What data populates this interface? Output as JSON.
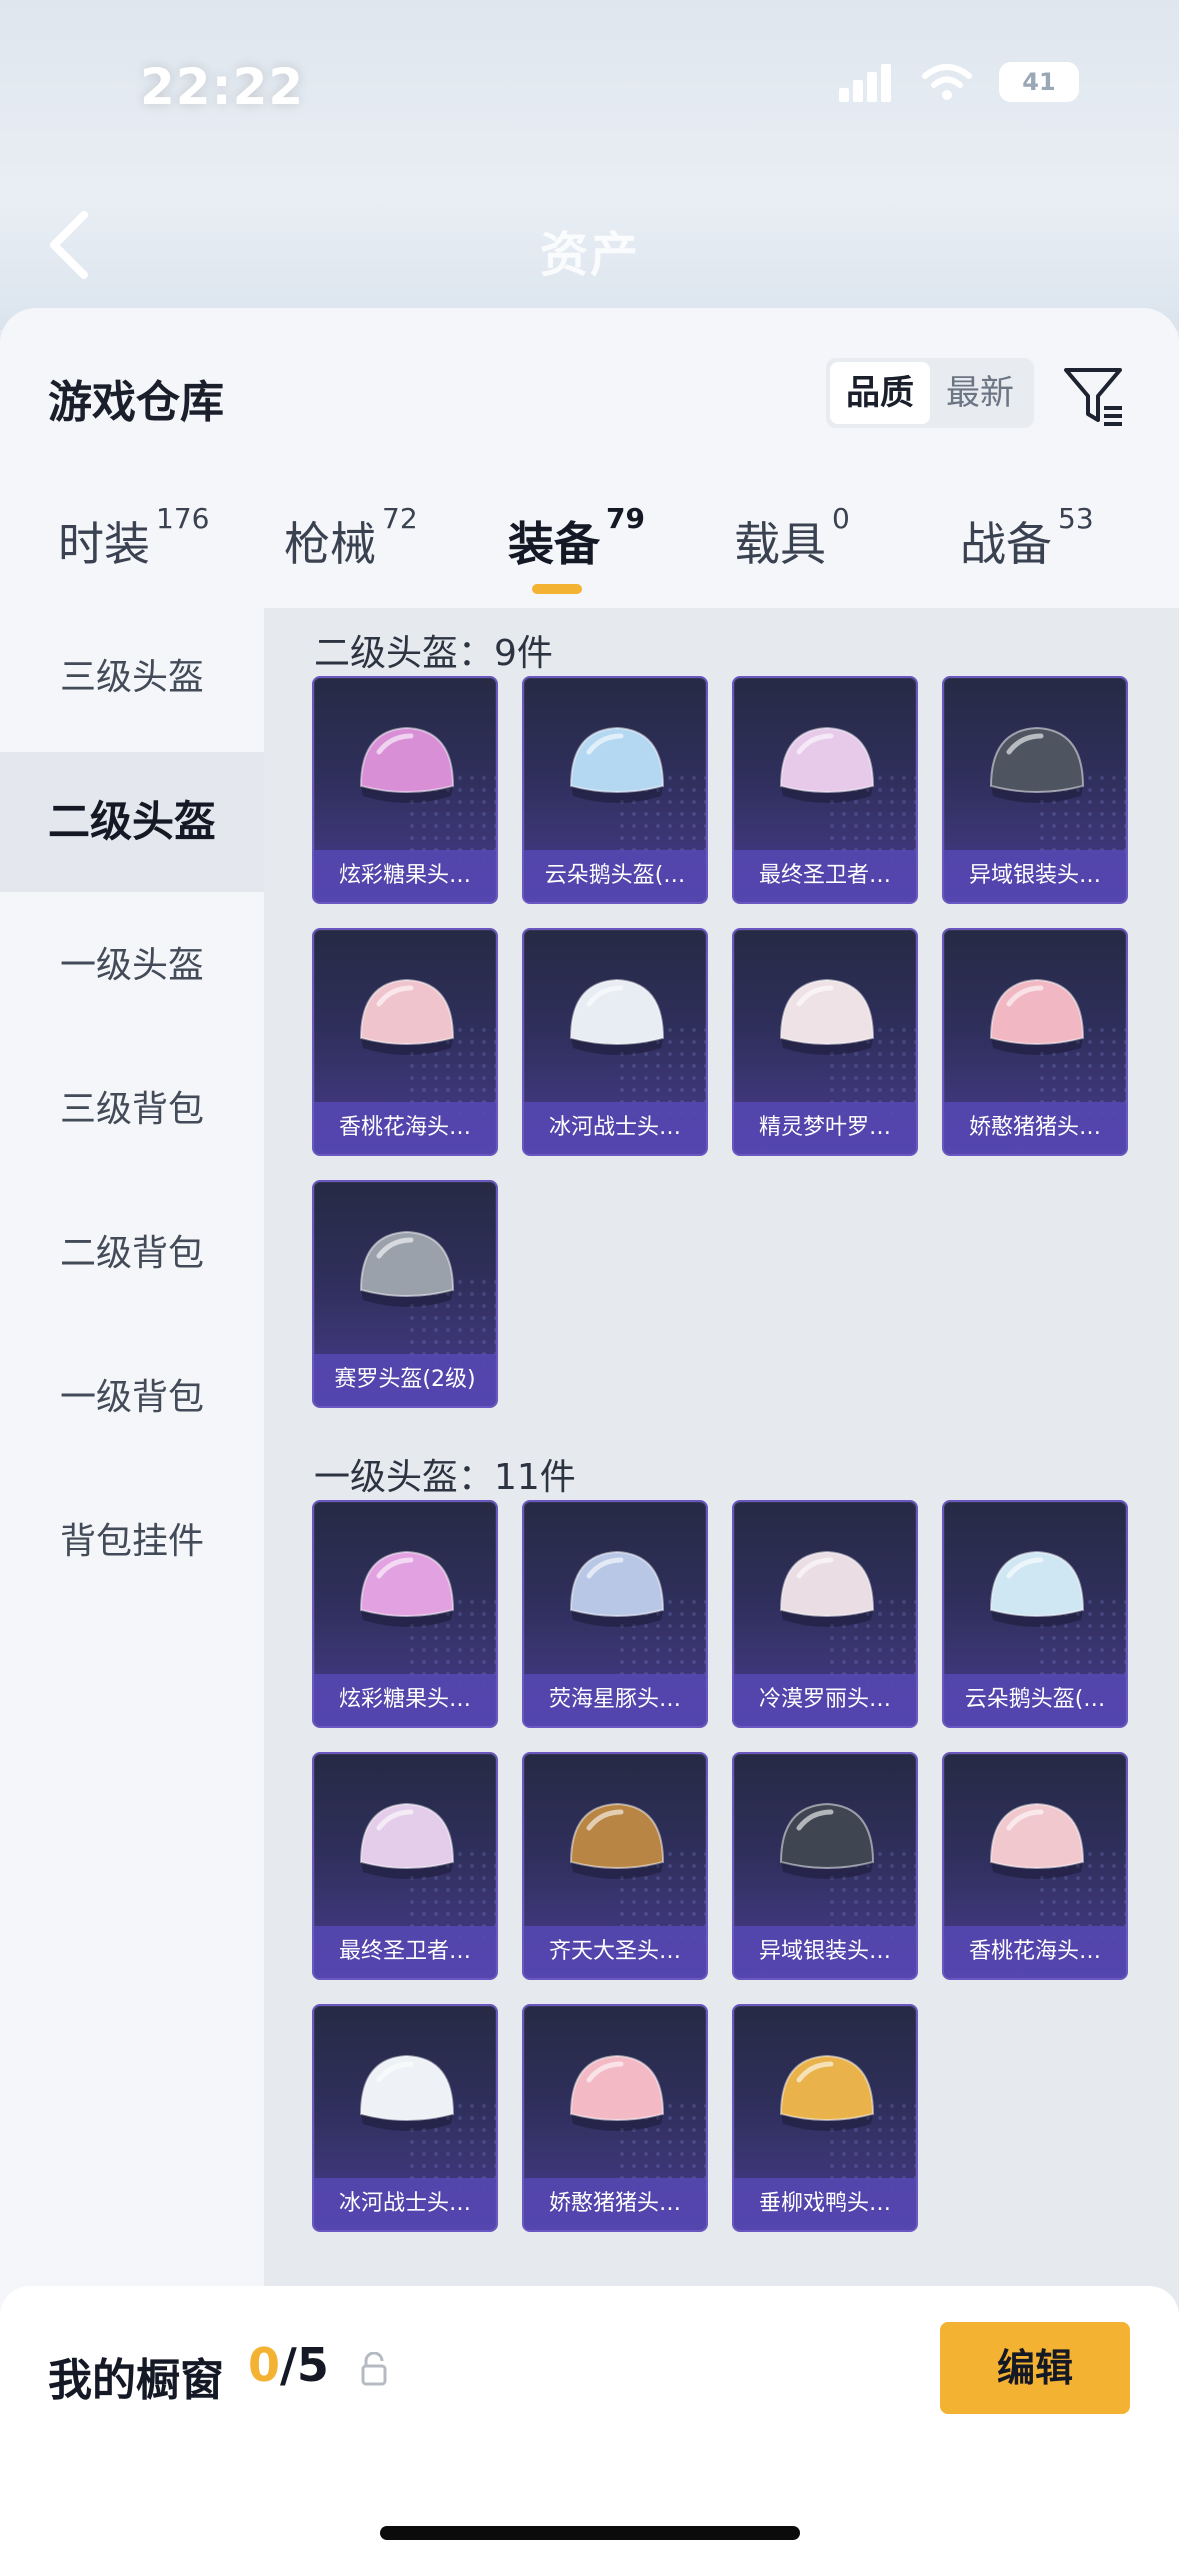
{
  "status_bar": {
    "time": "22:22",
    "battery": "41"
  },
  "top_nav": {
    "title": "资产"
  },
  "sheet": {
    "title": "游戏仓库",
    "sort": {
      "options": [
        "品质",
        "最新"
      ],
      "selected": "品质"
    }
  },
  "categories": [
    {
      "label": "时装",
      "count": "176"
    },
    {
      "label": "枪械",
      "count": "72"
    },
    {
      "label": "装备",
      "count": "79"
    },
    {
      "label": "载具",
      "count": "0"
    },
    {
      "label": "战备",
      "count": "53"
    }
  ],
  "active_category": "装备",
  "side_nav": {
    "items": [
      "三级头盔",
      "二级头盔",
      "一级头盔",
      "三级背包",
      "二级背包",
      "一级背包",
      "背包挂件"
    ],
    "active": "二级头盔"
  },
  "sections": [
    {
      "title": "二级头盔：9件",
      "items": [
        {
          "name": "炫彩糖果头…",
          "color": "#d88fd6"
        },
        {
          "name": "云朵鹅头盔(…",
          "color": "#b5d8f2"
        },
        {
          "name": "最终圣卫者…",
          "color": "#e7c9ea"
        },
        {
          "name": "异域银装头…",
          "color": "#4f5560"
        },
        {
          "name": "香桃花海头…",
          "color": "#f0c4cc"
        },
        {
          "name": "冰河战士头…",
          "color": "#e8ecf3"
        },
        {
          "name": "精灵梦叶罗…",
          "color": "#efe2e6"
        },
        {
          "name": "娇憨猪猪头…",
          "color": "#f1b7c2"
        },
        {
          "name": "赛罗头盔(2级)",
          "color": "#9aa1aa"
        }
      ]
    },
    {
      "title": "一级头盔：11件",
      "items": [
        {
          "name": "炫彩糖果头…",
          "color": "#e2a1e0"
        },
        {
          "name": "荧海星豚头…",
          "color": "#b8c7e6"
        },
        {
          "name": "冷漠罗丽头…",
          "color": "#eadde3"
        },
        {
          "name": "云朵鹅头盔(…",
          "color": "#cfe6f3"
        },
        {
          "name": "最终圣卫者…",
          "color": "#e4cdea"
        },
        {
          "name": "齐天大圣头…",
          "color": "#b98545"
        },
        {
          "name": "异域银装头…",
          "color": "#3f4652"
        },
        {
          "name": "香桃花海头…",
          "color": "#f2c8cf"
        },
        {
          "name": "冰河战士头…",
          "color": "#eef1f6"
        },
        {
          "name": "娇憨猪猪头…",
          "color": "#f3b9c5"
        },
        {
          "name": "垂柳戏鸭头…",
          "color": "#e9b24a"
        }
      ]
    }
  ],
  "bottom_bar": {
    "label": "我的橱窗",
    "count_current": "0",
    "count_total": "/5",
    "edit": "编辑"
  },
  "colors": {
    "accent": "#f4b233",
    "tile_border": "#6a58c0"
  }
}
